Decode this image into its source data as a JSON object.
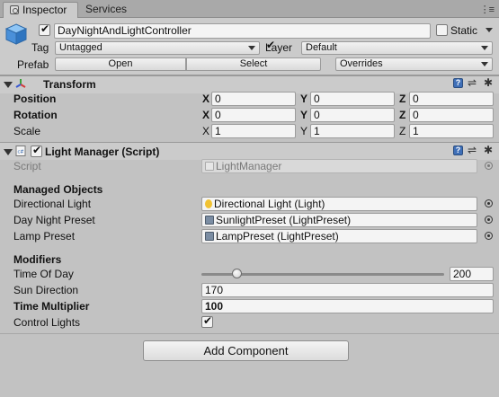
{
  "tabs": {
    "inspector": "Inspector",
    "services": "Services"
  },
  "gameobject": {
    "name": "DayNightAndLightController",
    "active": true,
    "static_label": "Static",
    "tag_label": "Tag",
    "tag_value": "Untagged",
    "layer_label": "Layer",
    "layer_value": "Default",
    "prefab_label": "Prefab",
    "prefab_open": "Open",
    "prefab_select": "Select",
    "prefab_overrides": "Overrides"
  },
  "transform": {
    "title": "Transform",
    "rows": [
      {
        "label": "Position",
        "x": "0",
        "y": "0",
        "z": "0"
      },
      {
        "label": "Rotation",
        "x": "0",
        "y": "0",
        "z": "0"
      },
      {
        "label": "Scale",
        "x": "1",
        "y": "1",
        "z": "1"
      }
    ],
    "axis_x": "X",
    "axis_y": "Y",
    "axis_z": "Z"
  },
  "light_manager": {
    "title": "Light Manager (Script)",
    "enabled": true,
    "script_label": "Script",
    "script_value": "LightManager",
    "managed_header": "Managed Objects",
    "directional_label": "Directional Light",
    "directional_value": "Directional Light (Light)",
    "daynight_label": "Day Night Preset",
    "daynight_value": "SunlightPreset (LightPreset)",
    "lamp_label": "Lamp Preset",
    "lamp_value": "LampPreset (LightPreset)",
    "modifiers_header": "Modifiers",
    "timeofday_label": "Time Of Day",
    "timeofday_value": "200",
    "timeofday_fraction": 0.13,
    "sundir_label": "Sun Direction",
    "sundir_value": "170",
    "timemult_label": "Time Multiplier",
    "timemult_value": "100",
    "controllights_label": "Control Lights",
    "controllights": true
  },
  "add_component": "Add Component",
  "colors": {
    "panel": "#cbcbcb",
    "background": "#c2c2c2",
    "help_blue": "#3f6fb7"
  }
}
